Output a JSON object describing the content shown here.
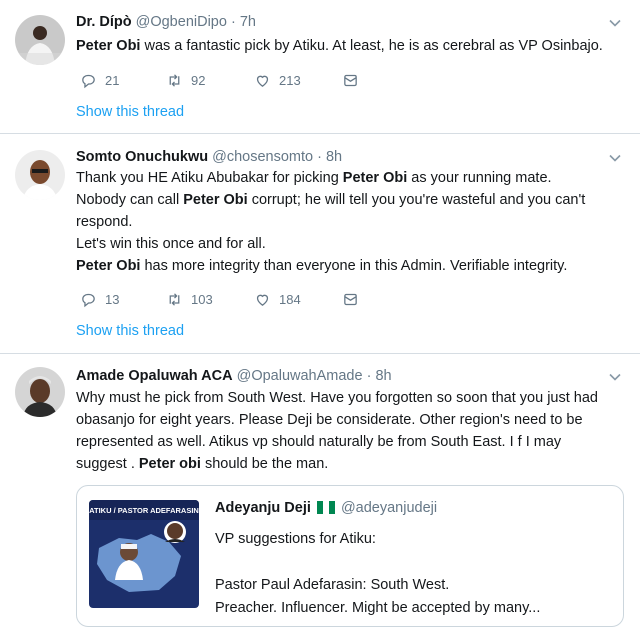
{
  "tweets": [
    {
      "name": "Dr. Dípò",
      "handle": "@OgbeniDipo",
      "time": "· 7h",
      "lines": [
        [
          {
            "b": "Peter Obi"
          },
          {
            "t": " was a fantastic pick by Atiku. At least, he is as cerebral as VP Osinbajo."
          }
        ]
      ],
      "replies": "21",
      "retweets": "92",
      "likes": "213",
      "show_thread": "Show this thread"
    },
    {
      "name": "Somto Onuchukwu",
      "handle": "@chosensomto",
      "time": "· 8h",
      "lines": [
        [
          {
            "t": "Thank you HE Atiku Abubakar for picking "
          },
          {
            "b": "Peter Obi"
          },
          {
            "t": " as your running mate."
          }
        ],
        [
          {
            "t": "Nobody can call "
          },
          {
            "b": "Peter Obi"
          },
          {
            "t": " corrupt; he will tell you you're wasteful and you can't"
          }
        ],
        [
          {
            "t": "respond."
          }
        ],
        [
          {
            "t": "Let's win this once and for all."
          }
        ],
        [
          {
            "b": "Peter Obi"
          },
          {
            "t": " has more integrity than everyone in this Admin. Verifiable integrity."
          }
        ]
      ],
      "replies": "13",
      "retweets": "103",
      "likes": "184",
      "show_thread": "Show this thread"
    },
    {
      "name": "Amade Opaluwah ACA",
      "handle": "@OpaluwahAmade",
      "time": "· 8h",
      "lines": [
        [
          {
            "t": "Why must he pick from South West. Have you forgotten so soon that you just had"
          }
        ],
        [
          {
            "t": "obasanjo for eight years. Please Deji be considerate. Other region's need to be"
          }
        ],
        [
          {
            "t": "represented as well. Atikus vp should naturally be from South East. I f I may"
          }
        ],
        [
          {
            "t": "suggest . "
          },
          {
            "b": "Peter obi"
          },
          {
            "t": " should be the man."
          }
        ]
      ],
      "quote": {
        "name": "Adeyanju Deji",
        "handle": "@adeyanjudeji",
        "image_caption": "ATIKU / PASTOR ADEFARASIN",
        "lines": [
          "VP suggestions for Atiku:",
          "",
          "Pastor Paul Adefarasin: South West.",
          "Preacher. Influencer. Might be accepted by many..."
        ]
      }
    }
  ],
  "colors": {
    "link": "#1da1f2",
    "muted": "#657786",
    "divider": "#d6dde3"
  }
}
